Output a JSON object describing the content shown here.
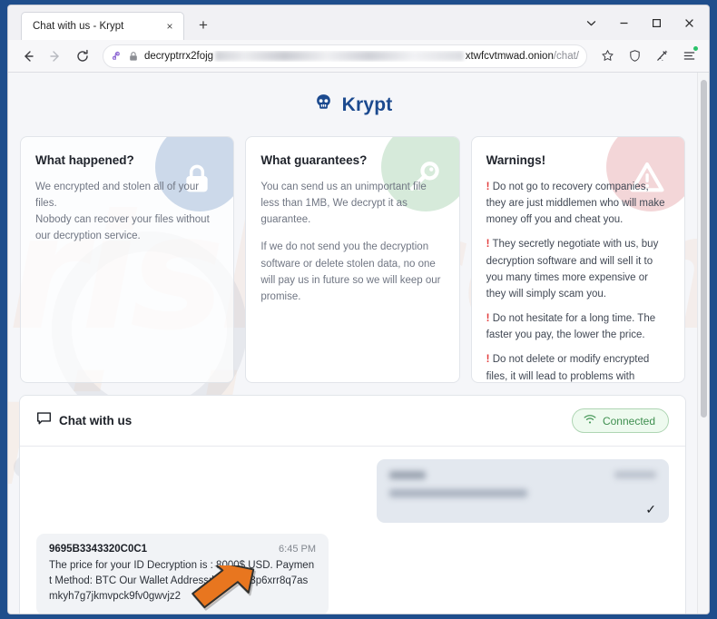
{
  "browser": {
    "tab": {
      "title": "Chat with us - Krypt",
      "close_label": "×"
    },
    "new_tab_label": "+",
    "window_controls": {
      "list_label": "⌄",
      "minimize": "–",
      "maximize": "□",
      "close": "✕"
    },
    "nav": {
      "back": "←",
      "forward": "→",
      "reload": "↻"
    },
    "url": {
      "prefix": "decryptrrx2fojg",
      "suffix_host": "xtwfcvtmwad.onion",
      "suffix_path": "/chat/",
      "redacted": true
    },
    "toolbar_icons": [
      "bookmark-star-icon",
      "shield-icon",
      "wand-icon",
      "menu-icon"
    ]
  },
  "site": {
    "brand": {
      "name": "Krypt",
      "icon": "skull-icon",
      "color": "#1c4a8f"
    },
    "cards": [
      {
        "id": "what-happened",
        "icon": "lock-icon",
        "badge_color": "#ccd9ea",
        "title": "What happened?",
        "paragraphs": [
          "We encrypted and stolen all of your files.\nNobody can recover your files without our decryption service."
        ]
      },
      {
        "id": "what-guarantees",
        "icon": "key-icon",
        "badge_color": "#d6eada",
        "title": "What guarantees?",
        "paragraphs": [
          "You can send us an unimportant file less than 1MB, We decrypt it as guarantee.",
          "If we do not send you the decryption software or delete stolen data, no one will pay us in future so we will keep our promise."
        ]
      },
      {
        "id": "warnings",
        "icon": "warning-triangle-icon",
        "badge_color": "#f3d6d8",
        "title": "Warnings!",
        "bullet_marker": "!",
        "paragraphs": [
          "Do not go to recovery companies, they are just middlemen who will make money off you and cheat you.",
          "They secretly negotiate with us, buy decryption software and will sell it to you many times more expensive or they will simply scam you.",
          "Do not hesitate for a long time. The faster you pay, the lower the price.",
          "Do not delete or modify encrypted files, it will lead to problems with decryption of files."
        ]
      }
    ],
    "chat": {
      "title": "Chat with us",
      "title_icon": "chat-bubble-icon",
      "status": {
        "label": "Connected",
        "icon": "wifi-icon",
        "color": "#3f8f50"
      },
      "messages": [
        {
          "direction": "outgoing",
          "redacted": true,
          "sender": "",
          "time": "",
          "text": "",
          "read_receipt": "✓"
        },
        {
          "direction": "incoming",
          "redacted": false,
          "sender": "9695B3343320C0C1",
          "time": "6:45 PM",
          "text": "The price for your ID Decryption is : 8000$ USD. Payment Method: BTC Our Wallet Address:bc1qlw53p6xrr8q7asmkyh7g7jkmvpck9fv0gwvjz2"
        }
      ]
    }
  },
  "annotations": {
    "arrow": {
      "name": "orange-arrow-annotation",
      "color": "#e8761f"
    }
  },
  "watermark": {
    "text_1": "risk.com",
    "text_2": "risk.com"
  }
}
